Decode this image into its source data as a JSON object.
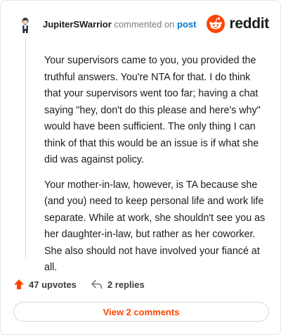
{
  "header": {
    "username": "JupiterSWarrior",
    "verb": "commented on",
    "post_link": "post",
    "brand": "reddit"
  },
  "comment": {
    "paragraphs": [
      "Your supervisors came to you, you provided the truthful answers. You're NTA for that. I do think that your supervisors went too far; having a chat saying \"hey, don't do this please and here's why\" would have been sufficient. The only thing I can think of that this would be an issue is if what she did was against policy.",
      "Your mother-in-law, however, is TA because she (and you) need to keep personal life and work life separate. While at work, she shouldn't see you as her daughter-in-law, but rather as her coworker. She also should not have involved your fiancé at all."
    ]
  },
  "actions": {
    "upvotes": "47 upvotes",
    "replies": "2 replies"
  },
  "footer": {
    "view_comments": "View 2 comments"
  },
  "colors": {
    "accent": "#ff4500",
    "link": "#0079d3"
  }
}
